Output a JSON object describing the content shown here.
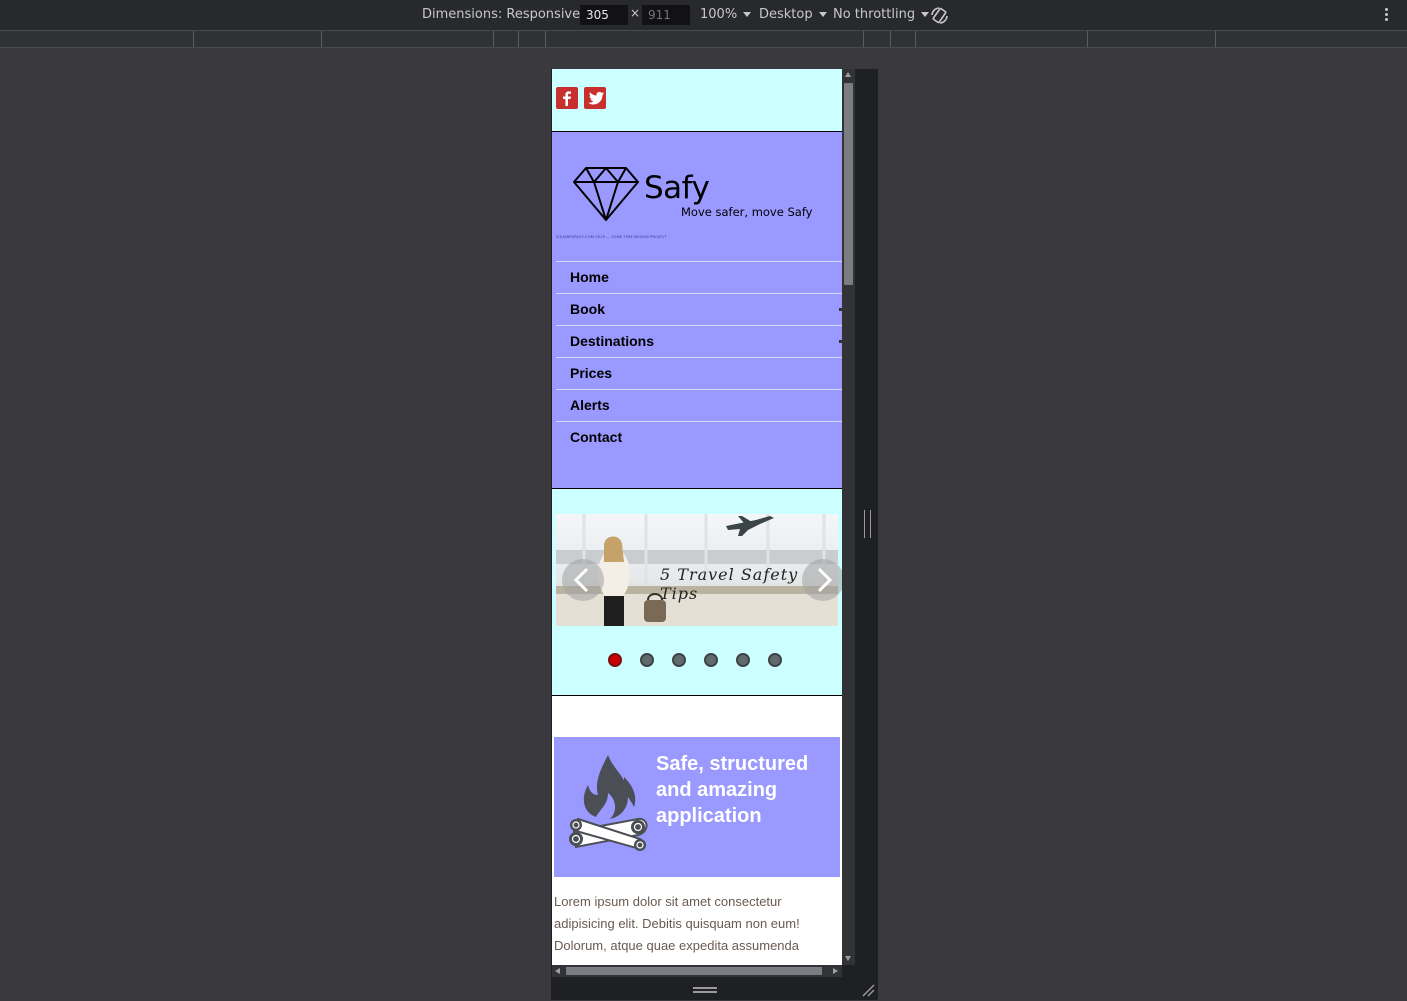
{
  "devtools": {
    "dimensions_label": "Dimensions: Responsive",
    "width_value": "305",
    "height_placeholder": "911",
    "times": "×",
    "zoom": "100%",
    "device_type": "Desktop",
    "throttling": "No throttling"
  },
  "site": {
    "social": [
      "facebook-icon",
      "twitter-icon"
    ],
    "brand": "Safy",
    "tagline": "Move safer, move Safy",
    "fine_print": "SQUARESPACE.COM 2019 — SOME TIME DESIGN PROJECT",
    "nav": [
      {
        "label": "Home",
        "has_submenu": false
      },
      {
        "label": "Book",
        "has_submenu": true
      },
      {
        "label": "Destinations",
        "has_submenu": true
      },
      {
        "label": "Prices",
        "has_submenu": false
      },
      {
        "label": "Alerts",
        "has_submenu": false
      },
      {
        "label": "Contact",
        "has_submenu": false
      }
    ],
    "slider": {
      "caption": "5 Travel Safety Tips",
      "dot_count": 6,
      "active_dot": 0
    },
    "feature": {
      "title": "Safe, structured and amazing application",
      "icon": "campfire-icon"
    },
    "body_text": "Lorem ipsum dolor sit amet consectetur adipisicing elit. Debitis quisquam non eum! Dolorum, atque quae expedita assumenda"
  },
  "colors": {
    "top_bar": "#ccffff",
    "header": "#9999ff",
    "social": "#c8302f",
    "active_dot": "#cc0000",
    "devtools_bg": "#28292d",
    "canvas_bg": "#3a3a3e"
  }
}
